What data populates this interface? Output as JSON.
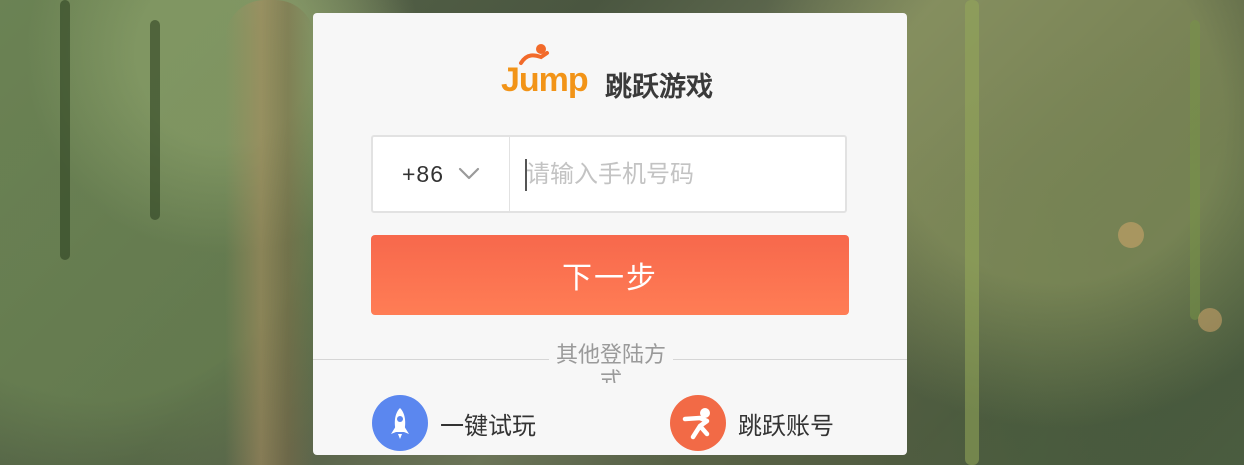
{
  "brand": {
    "logo_word": "Jump",
    "name_cn": "跳跃游戏",
    "accent": "#f29418"
  },
  "login": {
    "country_code": "+86",
    "phone_placeholder": "请输入手机号码",
    "next_label": "下一步",
    "next_color": "#f8704f"
  },
  "other_login": {
    "label": "其他登陆方式",
    "options": [
      {
        "label": "一键试玩",
        "icon": "rocket-icon",
        "color": "#5b87ef"
      },
      {
        "label": "跳跃账号",
        "icon": "jump-runner-icon",
        "color": "#f26a46"
      }
    ]
  }
}
